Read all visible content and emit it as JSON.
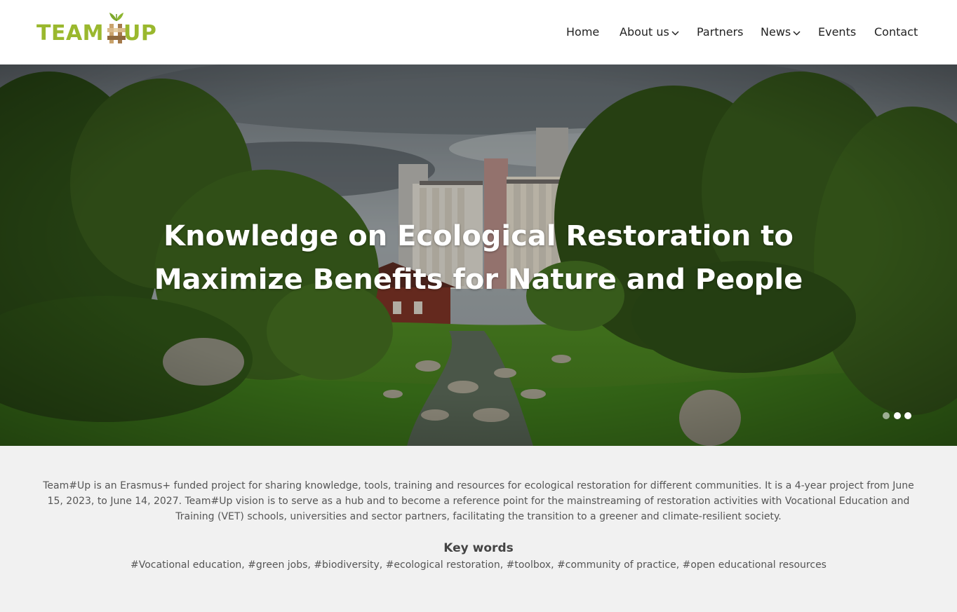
{
  "brand": {
    "name_left": "TEAM",
    "name_right": "UP",
    "color_primary": "#9ab82e",
    "color_mark": "#b08a5c"
  },
  "nav": {
    "items": [
      {
        "label": "Home",
        "has_dropdown": false
      },
      {
        "label": "About us",
        "has_dropdown": true
      },
      {
        "label": "Partners",
        "has_dropdown": false
      },
      {
        "label": "News",
        "has_dropdown": true
      },
      {
        "label": "Events",
        "has_dropdown": false
      },
      {
        "label": "Contact",
        "has_dropdown": false
      }
    ],
    "dropdown_icon": "chevron-down-icon"
  },
  "hero": {
    "title_line1": "Knowledge on Ecological Restoration to",
    "title_line2": "Maximize  Benefits for Nature and People",
    "slides_total": 3,
    "active_slide": 2
  },
  "intro": {
    "description": "Team#Up is an Erasmus+ funded project for sharing knowledge, tools, training and resources for ecological restoration for different communities. It is a 4-year project from June 15, 2023, to June 14, 2027. Team#Up vision is to serve as a hub and to become a reference point for the mainstreaming of restoration activities with Vocational Education and Training (VET) schools, universities and sector partners, facilitating the transition to a greener and climate-resilient society.",
    "keywords_title": "Key words",
    "keywords": "#Vocational education, #green jobs, #biodiversity, #ecological restoration, #toolbox, #community of practice, #open educational resources"
  },
  "colors": {
    "header_bg": "#ffffff",
    "section_bg": "#f1f1f1",
    "text": "#555555"
  }
}
